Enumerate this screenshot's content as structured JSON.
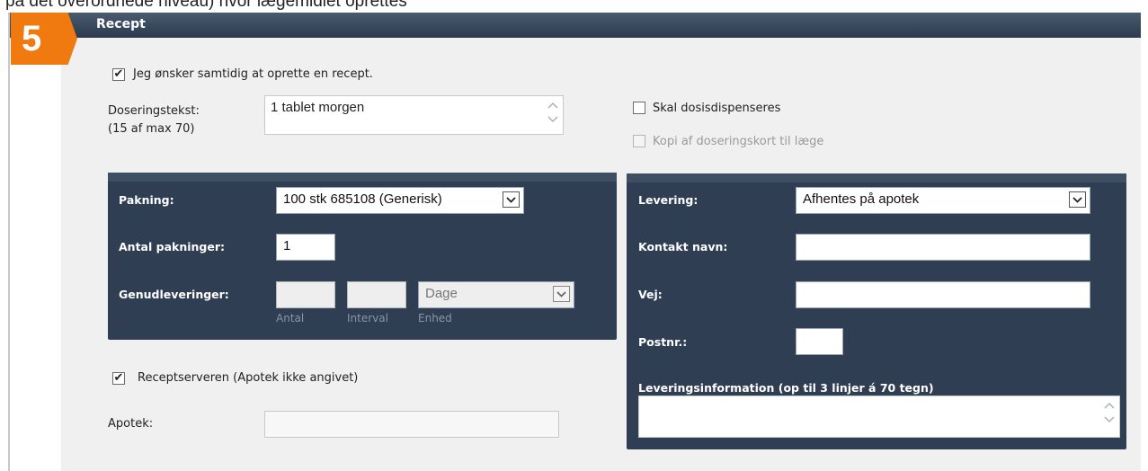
{
  "caption": "på det overordnede niveau) hvor lægemidlet oprettes",
  "section": {
    "number": "5",
    "title": "Recept"
  },
  "recept_checkbox": {
    "label": "Jeg ønsker samtidig at oprette en recept.",
    "checked": true
  },
  "dosering": {
    "label": "Doseringstekst:",
    "sublabel": "(15 af max 70)",
    "value": "1 tablet morgen"
  },
  "dosisdispensering": {
    "label": "Skal dosisdispenseres"
  },
  "kopi": {
    "label": "Kopi af doseringskort til læge"
  },
  "left_panel": {
    "pakning_label": "Pakning:",
    "pakning_value": "100 stk 685108 (Generisk)",
    "antal_label": "Antal pakninger:",
    "antal_value": "1",
    "genud_label": "Genudleveringer:",
    "enhed_value": "Dage",
    "sub_antal": "Antal",
    "sub_interval": "Interval",
    "sub_enhed": "Enhed"
  },
  "receptserver": {
    "label": "Receptserveren (Apotek ikke angivet)",
    "checked": true
  },
  "apotek_label": "Apotek:",
  "right_panel": {
    "levering_label": "Levering:",
    "levering_value": "Afhentes på apotek",
    "kontakt_label": "Kontakt navn:",
    "vej_label": "Vej:",
    "postnr_label": "Postnr.:",
    "leveringsinfo_label": "Leveringsinformation (op til 3 linjer á 70 tegn)"
  },
  "colors": {
    "header": "#2b3a4d",
    "badge": "#f07a10",
    "panel": "#2f3e52"
  }
}
